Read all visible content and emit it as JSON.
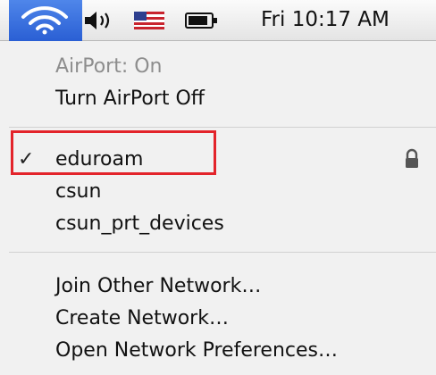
{
  "menubar": {
    "icons": [
      "wifi-icon",
      "volume-icon",
      "us-flag-icon",
      "battery-icon"
    ],
    "clock": "Fri 10:17 AM",
    "accent": "#2e63d6"
  },
  "menu": {
    "status": "AirPort: On",
    "turn_off": "Turn AirPort Off",
    "networks": [
      {
        "name": "eduroam",
        "selected": true,
        "locked": true
      },
      {
        "name": "csun",
        "selected": false,
        "locked": false
      },
      {
        "name": "csun_prt_devices",
        "selected": false,
        "locked": false
      }
    ],
    "check_mark": "✓",
    "join_other": "Join Other Network…",
    "create": "Create Network…",
    "prefs": "Open Network Preferences…"
  },
  "annotation": {
    "color": "#e3242b"
  }
}
